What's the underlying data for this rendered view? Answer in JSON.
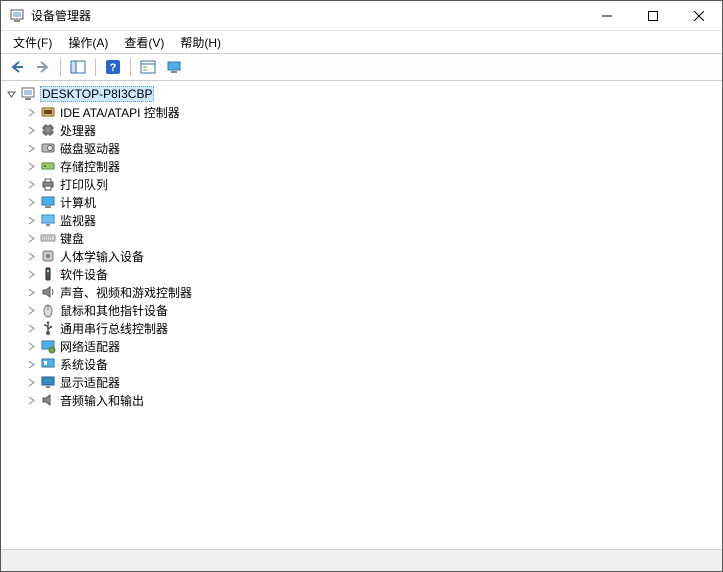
{
  "window": {
    "title": "设备管理器"
  },
  "menubar": {
    "items": [
      {
        "label": "文件(F)"
      },
      {
        "label": "操作(A)"
      },
      {
        "label": "查看(V)"
      },
      {
        "label": "帮助(H)"
      }
    ]
  },
  "toolbar": {
    "icons": {
      "back": "back-arrow-icon",
      "forward": "forward-arrow-icon",
      "show_hide": "show-hide-tree-icon",
      "help": "help-icon",
      "properties": "properties-icon",
      "monitor": "monitor-icon"
    }
  },
  "tree": {
    "root": {
      "label": "DESKTOP-P8I3CBP",
      "expanded": true,
      "icon": "computer-icon"
    },
    "categories": [
      {
        "label": "IDE ATA/ATAPI 控制器",
        "icon": "ide-controller-icon"
      },
      {
        "label": "处理器",
        "icon": "cpu-icon"
      },
      {
        "label": "磁盘驱动器",
        "icon": "disk-drive-icon"
      },
      {
        "label": "存储控制器",
        "icon": "storage-controller-icon"
      },
      {
        "label": "打印队列",
        "icon": "printer-icon"
      },
      {
        "label": "计算机",
        "icon": "computer-icon"
      },
      {
        "label": "监视器",
        "icon": "monitor-icon"
      },
      {
        "label": "键盘",
        "icon": "keyboard-icon"
      },
      {
        "label": "人体学输入设备",
        "icon": "hid-icon"
      },
      {
        "label": "软件设备",
        "icon": "software-device-icon"
      },
      {
        "label": "声音、视频和游戏控制器",
        "icon": "sound-icon"
      },
      {
        "label": "鼠标和其他指针设备",
        "icon": "mouse-icon"
      },
      {
        "label": "通用串行总线控制器",
        "icon": "usb-icon"
      },
      {
        "label": "网络适配器",
        "icon": "network-adapter-icon"
      },
      {
        "label": "系统设备",
        "icon": "system-device-icon"
      },
      {
        "label": "显示适配器",
        "icon": "display-adapter-icon"
      },
      {
        "label": "音频输入和输出",
        "icon": "audio-io-icon"
      }
    ]
  }
}
